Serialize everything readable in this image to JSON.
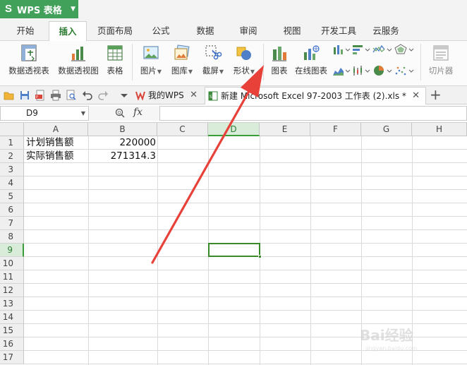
{
  "app": {
    "name": "WPS 表格"
  },
  "menu_tabs": [
    {
      "label": "开始"
    },
    {
      "label": "插入"
    },
    {
      "label": "页面布局"
    },
    {
      "label": "公式"
    },
    {
      "label": "数据"
    },
    {
      "label": "审阅"
    },
    {
      "label": "视图"
    },
    {
      "label": "开发工具"
    },
    {
      "label": "云服务"
    }
  ],
  "active_menu_tab": "插入",
  "ribbon": {
    "pivot_table": "数据透视表",
    "pivot_chart": "数据透视图",
    "table": "表格",
    "picture": "图片",
    "gallery": "图库",
    "screenshot": "截屏",
    "shapes": "形状",
    "chart": "图表",
    "online_chart": "在线图表",
    "slicer": "切片器"
  },
  "doc_tabs": [
    {
      "label": "我的WPS"
    },
    {
      "label": "新建 Microsoft Excel 97-2003 工作表 (2).xls *"
    }
  ],
  "formula_bar": {
    "name_box": "D9",
    "fx_label": "fx",
    "formula": ""
  },
  "grid": {
    "columns": [
      "A",
      "B",
      "C",
      "D",
      "E",
      "F",
      "G",
      "H"
    ],
    "rows": [
      "1",
      "2",
      "3",
      "4",
      "5",
      "6",
      "7",
      "8",
      "9",
      "10",
      "11",
      "12",
      "13",
      "14",
      "15",
      "16",
      "17"
    ],
    "selected_column": "D",
    "selected_row": "9",
    "cells": {
      "A1": "计划销售额",
      "B1": "220000",
      "A2": "实际销售额",
      "B2": "271314.3"
    }
  },
  "colors": {
    "accent_green": "#41a05a",
    "selection_green": "#3a8a2a",
    "arrow_red": "#e8413a"
  },
  "watermark": {
    "text": "Bai经验",
    "subtext": "jingyan.baidu.com"
  }
}
